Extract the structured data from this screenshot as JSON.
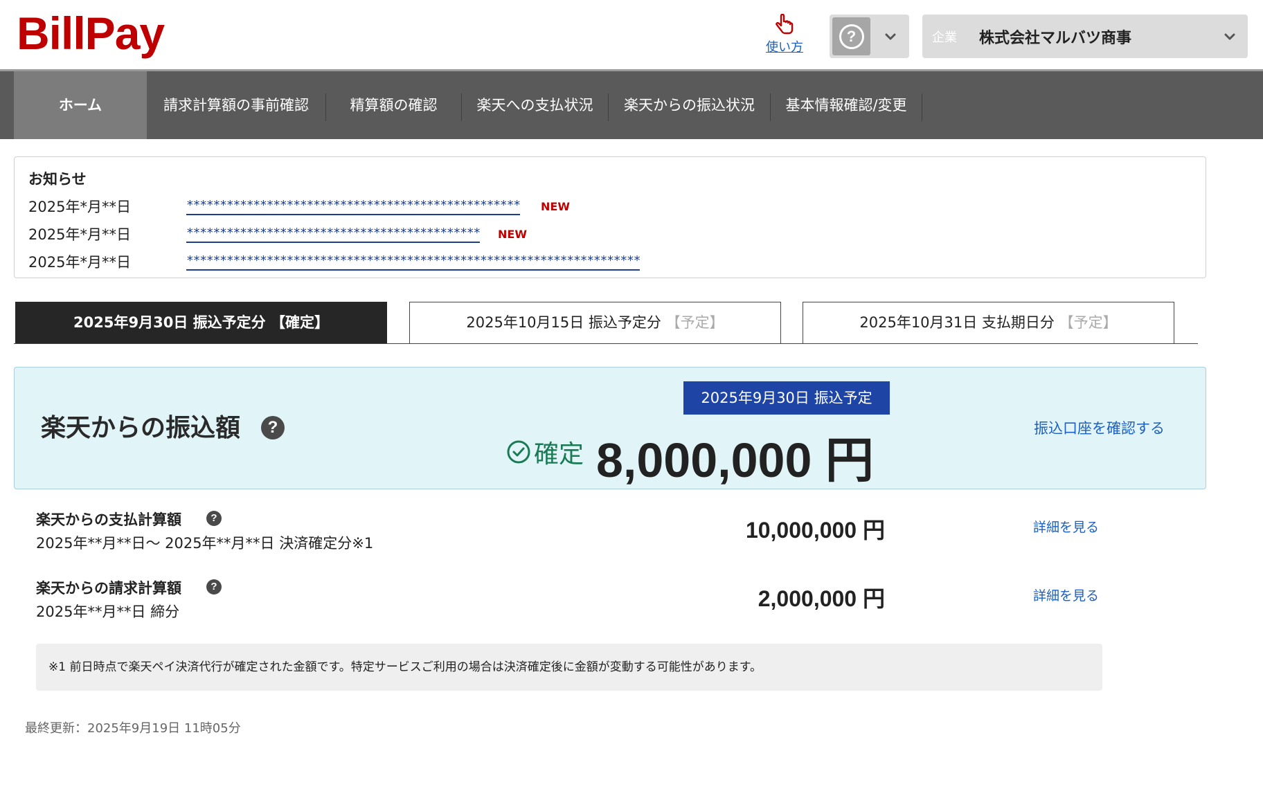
{
  "header": {
    "logo": "BillPay",
    "howto_label": "使い方",
    "company_label": "企業",
    "company_name": "株式会社マルバツ商事"
  },
  "nav": {
    "items": [
      {
        "label": "ホーム",
        "active": true
      },
      {
        "label": "請求計算額の事前確認"
      },
      {
        "label": "精算額の確認"
      },
      {
        "label": "楽天への支払状況"
      },
      {
        "label": "楽天からの振込状況"
      },
      {
        "label": "基本情報確認/変更"
      }
    ]
  },
  "notice": {
    "title": "お知らせ",
    "items": [
      {
        "date": "2025年*月**日",
        "text": "**************************************************",
        "new": "NEW"
      },
      {
        "date": "2025年*月**日",
        "text": "********************************************",
        "new": "NEW"
      },
      {
        "date": "2025年*月**日",
        "text": "********************************************************************",
        "new": ""
      }
    ]
  },
  "tabs": [
    {
      "label": "2025年9月30日 振込予定分 ",
      "status": "【確定】",
      "active": true
    },
    {
      "label": "2025年10月15日 振込予定分 ",
      "status": "【予定】"
    },
    {
      "label": "2025年10月31日 支払期日分 ",
      "status": "【予定】"
    }
  ],
  "transfer": {
    "title": "楽天からの振込額",
    "schedule_badge": "2025年9月30日 振込予定",
    "status": "確定",
    "amount": "8,000,000 円",
    "account_link": "振込口座を確認する"
  },
  "items": [
    {
      "label": "楽天からの支払計算額",
      "sub": "2025年**月**日〜 2025年**月**日 決済確定分※1",
      "amount": "10,000,000 円",
      "link": "詳細を見る"
    },
    {
      "label": "楽天からの請求計算額",
      "sub": "2025年**月**日 締分",
      "amount": "2,000,000 円",
      "link": "詳細を見る"
    }
  ],
  "footnote": "※1 前日時点で楽天ペイ決済代行が確定された金額です。特定サービスご利用の場合は決済確定後に金額が変動する可能性があります。",
  "last_updated": "最終更新：2025年9月19日 11時05分",
  "colors": {
    "brand": "#bf0000",
    "nav": "#5a5a5a",
    "link": "#1d5fc2",
    "badge": "#1e44a6",
    "confirmed": "#1a7a54",
    "panel": "#e1f5f9"
  }
}
